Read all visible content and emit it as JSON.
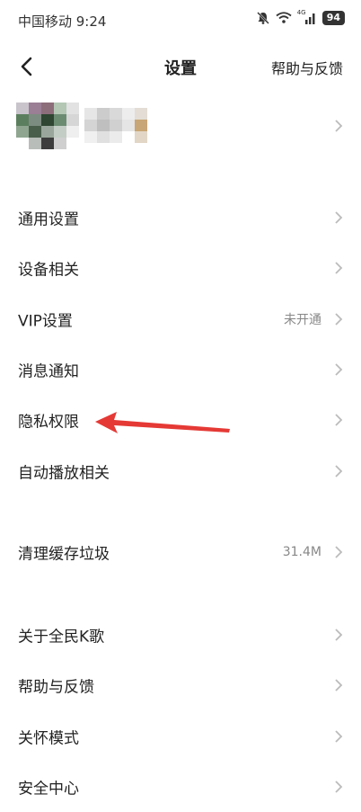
{
  "status_bar": {
    "carrier_time": "中国移动 9:24",
    "signal_label": "4G",
    "battery": "94",
    "icons": [
      "mute-bell-icon",
      "wifi-icon",
      "cellular-signal-icon",
      "battery-icon"
    ]
  },
  "nav": {
    "title": "设置",
    "help": "帮助与反馈",
    "back_icon": "back-arrow-icon"
  },
  "groups": [
    {
      "items": [
        {
          "label": "通用设置",
          "value": ""
        },
        {
          "label": "设备相关",
          "value": ""
        },
        {
          "label": "VIP设置",
          "value": "未开通"
        },
        {
          "label": "消息通知",
          "value": ""
        },
        {
          "label": "隐私权限",
          "value": ""
        },
        {
          "label": "自动播放相关",
          "value": ""
        }
      ]
    },
    {
      "items": [
        {
          "label": "清理缓存垃圾",
          "value": "31.4M"
        }
      ]
    },
    {
      "items": [
        {
          "label": "关于全民K歌",
          "value": ""
        },
        {
          "label": "帮助与反馈",
          "value": ""
        },
        {
          "label": "关怀模式",
          "value": ""
        },
        {
          "label": "安全中心",
          "value": ""
        }
      ]
    }
  ],
  "colors": {
    "annotation_arrow": "#e53935",
    "chevron": "#bbbbbb",
    "secondary_text": "#888888"
  }
}
